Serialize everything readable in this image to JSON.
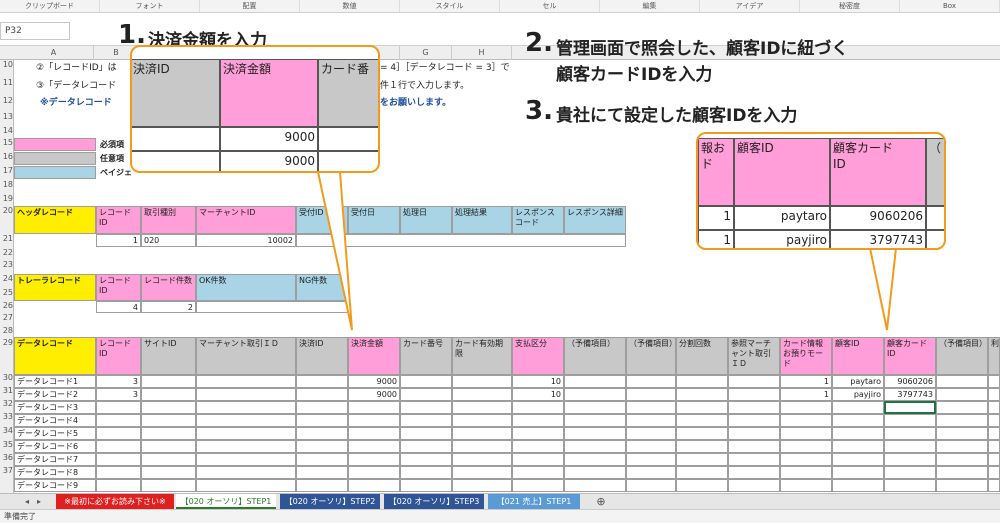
{
  "ribbon": [
    "クリップボード",
    "フォント",
    "配置",
    "数値",
    "スタイル",
    "セル",
    "編集",
    "アイデア",
    "秘密度",
    "Box"
  ],
  "namebox": "P32",
  "columns": [
    "A",
    "B",
    "C",
    "D",
    "E",
    "F",
    "G",
    "H"
  ],
  "rows": [
    "10",
    "11",
    "12",
    "13",
    "14",
    "15",
    "16",
    "17",
    "18",
    "19",
    "20",
    "21",
    "22",
    "23",
    "24",
    "25",
    "26",
    "27",
    "28",
    "29",
    "30",
    "31",
    "32",
    "33",
    "34",
    "35",
    "36",
    "37"
  ],
  "notes": {
    "line10a": "②「レコードID」は",
    "line10b": "= 4］［データレコード = 3］で",
    "line11a": "③「データレコード",
    "line11b": "件１行で入力します。",
    "line12a": "※データレコード",
    "line12b": "をお願いします。"
  },
  "legend": {
    "required": "必須項",
    "optional": "任意項",
    "pay": "ペイジェ"
  },
  "steps": {
    "s1_num": "1.",
    "s1_text": "決済金額を入力",
    "s2_num": "2.",
    "s2_text_1": "管理画面で照会した、顧客IDに紐づく",
    "s2_text_2": "顧客カードIDを入力",
    "s3_num": "3.",
    "s3_text": "貴社にて設定した顧客IDを入力"
  },
  "callout1": {
    "h1": "決済ID",
    "h2": "決済金額",
    "h3": "カード番",
    "v1": "9000",
    "v2": "9000"
  },
  "callout2": {
    "h0": "報お",
    "h0b": "ド",
    "h1": "顧客ID",
    "h2": "顧客カード",
    "h2b": "ID",
    "h3": "（",
    "r1a": "1",
    "r1b": "paytaro",
    "r1c": "9060206",
    "r2a": "1",
    "r2b": "payjiro",
    "r2c": "3797743"
  },
  "header_record": {
    "label": "ヘッダレコード",
    "cols": [
      "レコード ID",
      "取引種別",
      "マーチャントID",
      "受付ID",
      "受付日",
      "処理日",
      "処理結果",
      "レスポンス コード",
      "レスポンス詳細"
    ],
    "vals": [
      "1",
      "020",
      "10002"
    ]
  },
  "trailer_record": {
    "label": "トレーラレコード",
    "cols": [
      "レコード ID",
      "レコード件数",
      "OK件数",
      "NG件数"
    ],
    "vals": [
      "4",
      "2"
    ]
  },
  "data_record": {
    "label": "データレコード",
    "cols": [
      "レコード ID",
      "サイトID",
      "マーチャント取引ＩＤ",
      "決済ID",
      "決済金額",
      "カード番号",
      "カード有効期限",
      "支払区分",
      "（予備項目）",
      "（予備項目）",
      "分割回数",
      "参照マーチャント取引ＩＤ",
      "カード情報お預りモード",
      "顧客ID",
      "顧客カード ID",
      "（予備項目）",
      "利"
    ],
    "rows": [
      {
        "label": "データレコード1",
        "id": "3",
        "amount": "9000",
        "pay": "10",
        "mode": "1",
        "cust": "paytaro",
        "card": "9060206"
      },
      {
        "label": "データレコード2",
        "id": "3",
        "amount": "9000",
        "pay": "10",
        "mode": "1",
        "cust": "payjiro",
        "card": "3797743"
      },
      {
        "label": "データレコード3"
      },
      {
        "label": "データレコード4"
      },
      {
        "label": "データレコード5"
      },
      {
        "label": "データレコード6"
      },
      {
        "label": "データレコード7"
      },
      {
        "label": "データレコード8"
      },
      {
        "label": "データレコード9"
      }
    ]
  },
  "tabs": [
    "※最初に必ずお読み下さい※",
    "【020 オーソリ】STEP1",
    "【020 オーソリ】STEP2",
    "【020 オーソリ】STEP3",
    "【021 売上】STEP1"
  ],
  "status": "準備完了",
  "colors": {
    "accent": "#f39a1c",
    "pink": "#ff9ed8",
    "blue": "#a8d4e6",
    "yellow": "#ffee00",
    "grey": "#c8c8c8"
  }
}
